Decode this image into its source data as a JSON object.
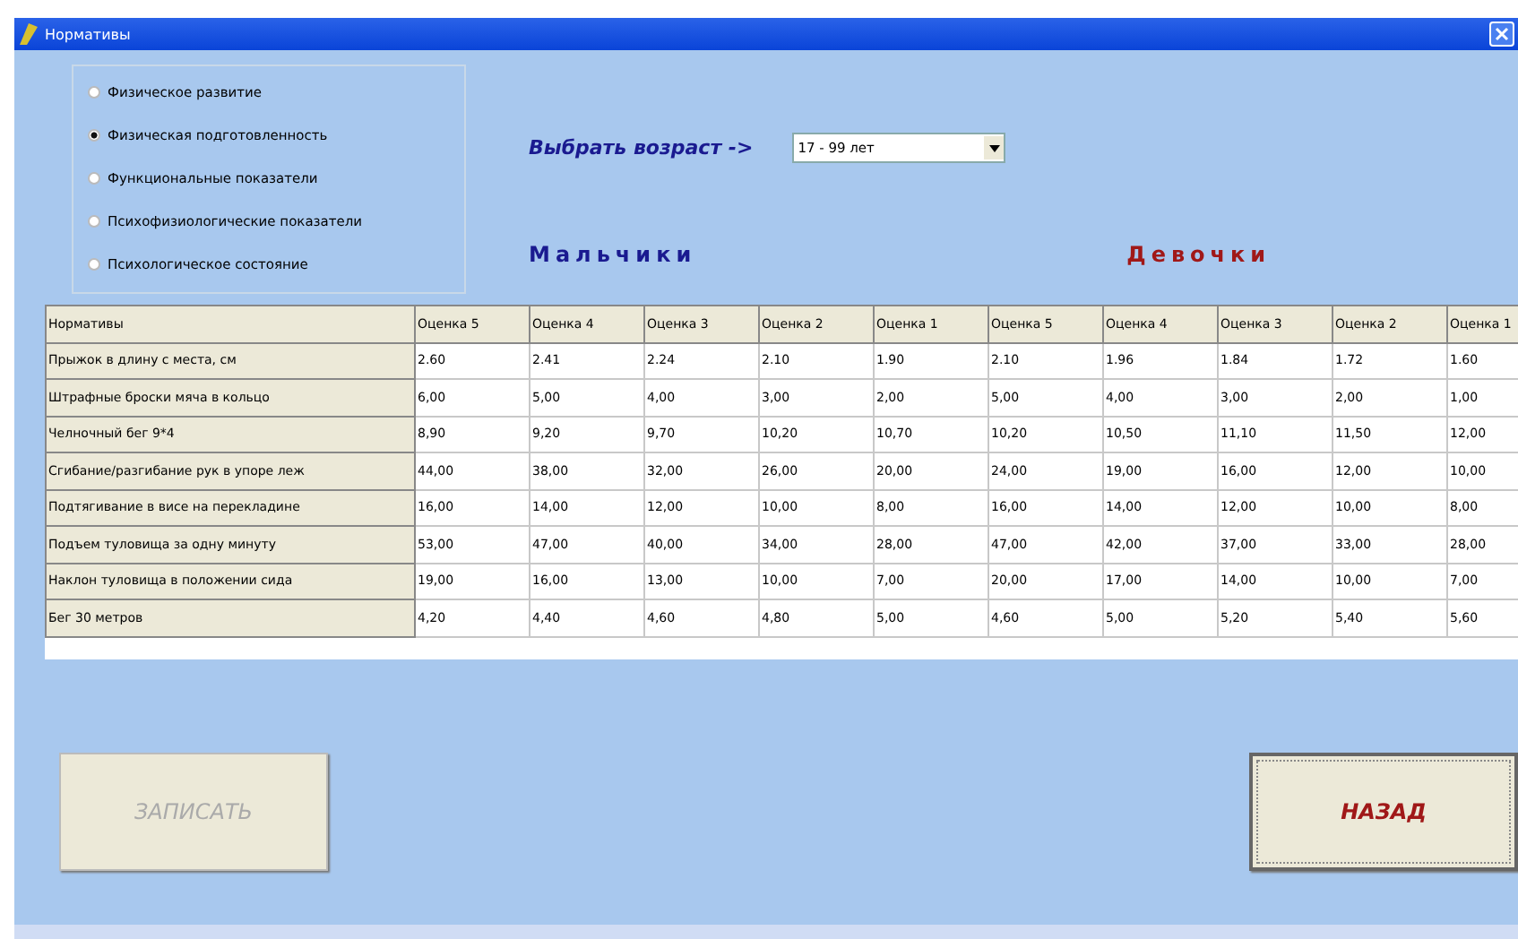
{
  "window": {
    "title": "Нормативы"
  },
  "categories": [
    {
      "label": "Физическое развитие",
      "selected": false
    },
    {
      "label": "Физическая подготовленность",
      "selected": true
    },
    {
      "label": "Функциональные показатели",
      "selected": false
    },
    {
      "label": "Психофизиологические показатели",
      "selected": false
    },
    {
      "label": "Психологическое состояние",
      "selected": false
    }
  ],
  "age": {
    "label": "Выбрать возраст ->",
    "value": "17 - 99 лет"
  },
  "groups": [
    "Мальчики",
    "Девочки"
  ],
  "table": {
    "columns": [
      "Нормативы",
      "Оценка 5",
      "Оценка 4",
      "Оценка 3",
      "Оценка 2",
      "Оценка 1",
      "Оценка 5",
      "Оценка 4",
      "Оценка 3",
      "Оценка 2",
      "Оценка 1"
    ],
    "rows": [
      [
        "Прыжок в длину с места, см",
        "2.60",
        "2.41",
        "2.24",
        "2.10",
        "1.90",
        "2.10",
        "1.96",
        "1.84",
        "1.72",
        "1.60"
      ],
      [
        "Штрафные броски мяча в кольцо",
        "6,00",
        "5,00",
        "4,00",
        "3,00",
        "2,00",
        "5,00",
        "4,00",
        "3,00",
        "2,00",
        "1,00"
      ],
      [
        "Челночный бег 9*4",
        "8,90",
        "9,20",
        "9,70",
        "10,20",
        "10,70",
        "10,20",
        "10,50",
        "11,10",
        "11,50",
        "12,00"
      ],
      [
        "Сгибание/разгибание рук в упоре леж",
        "44,00",
        "38,00",
        "32,00",
        "26,00",
        "20,00",
        "24,00",
        "19,00",
        "16,00",
        "12,00",
        "10,00"
      ],
      [
        "Подтягивание в висе на перекладине",
        "16,00",
        "14,00",
        "12,00",
        "10,00",
        "8,00",
        "16,00",
        "14,00",
        "12,00",
        "10,00",
        "8,00"
      ],
      [
        "Подъем туловища за одну минуту",
        "53,00",
        "47,00",
        "40,00",
        "34,00",
        "28,00",
        "47,00",
        "42,00",
        "37,00",
        "33,00",
        "28,00"
      ],
      [
        "Наклон туловища в положении сида",
        "19,00",
        "16,00",
        "13,00",
        "10,00",
        "7,00",
        "20,00",
        "17,00",
        "14,00",
        "10,00",
        "7,00"
      ],
      [
        "Бег 30 метров",
        "4,20",
        "4,40",
        "4,60",
        "4,80",
        "5,00",
        "4,60",
        "5,00",
        "5,20",
        "5,40",
        "5,60"
      ]
    ]
  },
  "buttons": [
    {
      "label": "ЗАПИСАТЬ",
      "disabled": true
    },
    {
      "label": "НАЗАД",
      "disabled": false
    }
  ]
}
